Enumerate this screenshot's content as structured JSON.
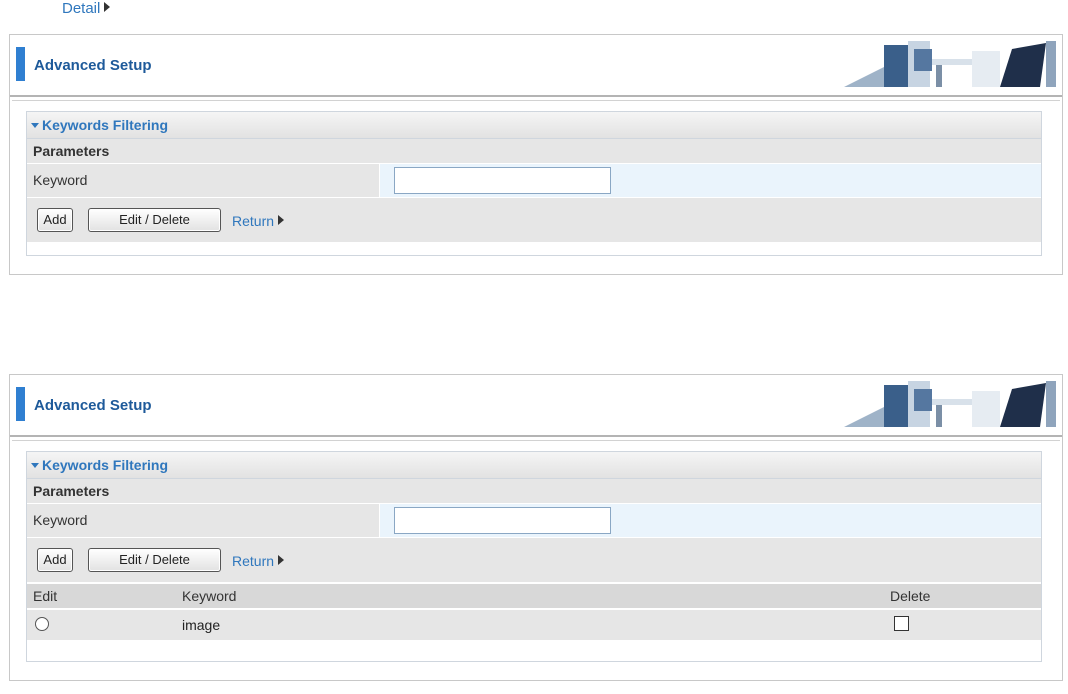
{
  "top_link": "Detail",
  "panels": [
    {
      "title": "Advanced Setup",
      "section": "Keywords Filtering",
      "params_label": "Parameters",
      "keyword_label": "Keyword",
      "keyword_value": "",
      "add_label": "Add",
      "edit_delete_label": "Edit / Delete",
      "return_label": "Return"
    },
    {
      "title": "Advanced Setup",
      "section": "Keywords Filtering",
      "params_label": "Parameters",
      "keyword_label": "Keyword",
      "keyword_value": "",
      "add_label": "Add",
      "edit_delete_label": "Edit / Delete",
      "return_label": "Return",
      "table": {
        "headers": [
          "Edit",
          "Keyword",
          "Delete"
        ],
        "rows": [
          {
            "keyword": "image",
            "edit_selected": false,
            "delete_checked": false
          }
        ]
      }
    }
  ],
  "colors": {
    "accent": "#2f77bd",
    "row_bg": "#e6e6e6",
    "input_row_bg": "#eaf4fc"
  }
}
